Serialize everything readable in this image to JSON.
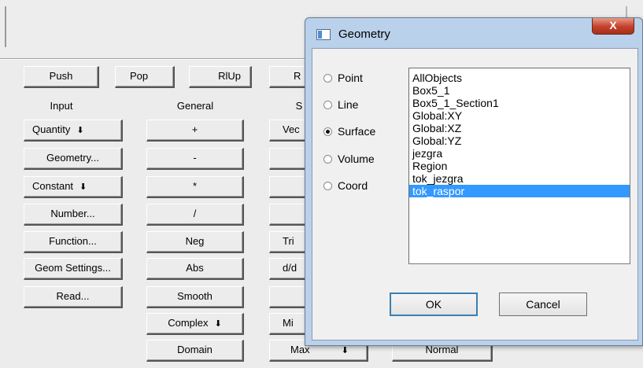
{
  "stack_buttons": {
    "push": "Push",
    "pop": "Pop",
    "rlup": "RlUp",
    "r": "R"
  },
  "column_headers": {
    "input": "Input",
    "general": "General",
    "s": "S"
  },
  "input_buttons": [
    "Quantity",
    "Geometry...",
    "Constant",
    "Number...",
    "Function...",
    "Geom Settings...",
    "Read..."
  ],
  "dropdown_arrow": "⬇",
  "general_buttons": [
    "+",
    "-",
    "*",
    "/",
    "Neg",
    "Abs",
    "Smooth",
    "Complex",
    "Domain"
  ],
  "third_buttons": [
    "Vec",
    "",
    "",
    "",
    "Tri",
    "d/d",
    "",
    "Mi",
    "Max"
  ],
  "fourth_buttons": [
    "Normal"
  ],
  "dialog": {
    "title": "Geometry",
    "close_label": "X",
    "radio_options": [
      "Point",
      "Line",
      "Surface",
      "Volume",
      "Coord"
    ],
    "selected_radio": "Surface",
    "list_items": [
      "AllObjects",
      "Box5_1",
      "Box5_1_Section1",
      "Global:XY",
      "Global:XZ",
      "Global:YZ",
      "jezgra",
      "Region",
      "tok_jezgra",
      "tok_raspor"
    ],
    "selected_item": "tok_raspor",
    "ok_label": "OK",
    "cancel_label": "Cancel"
  }
}
